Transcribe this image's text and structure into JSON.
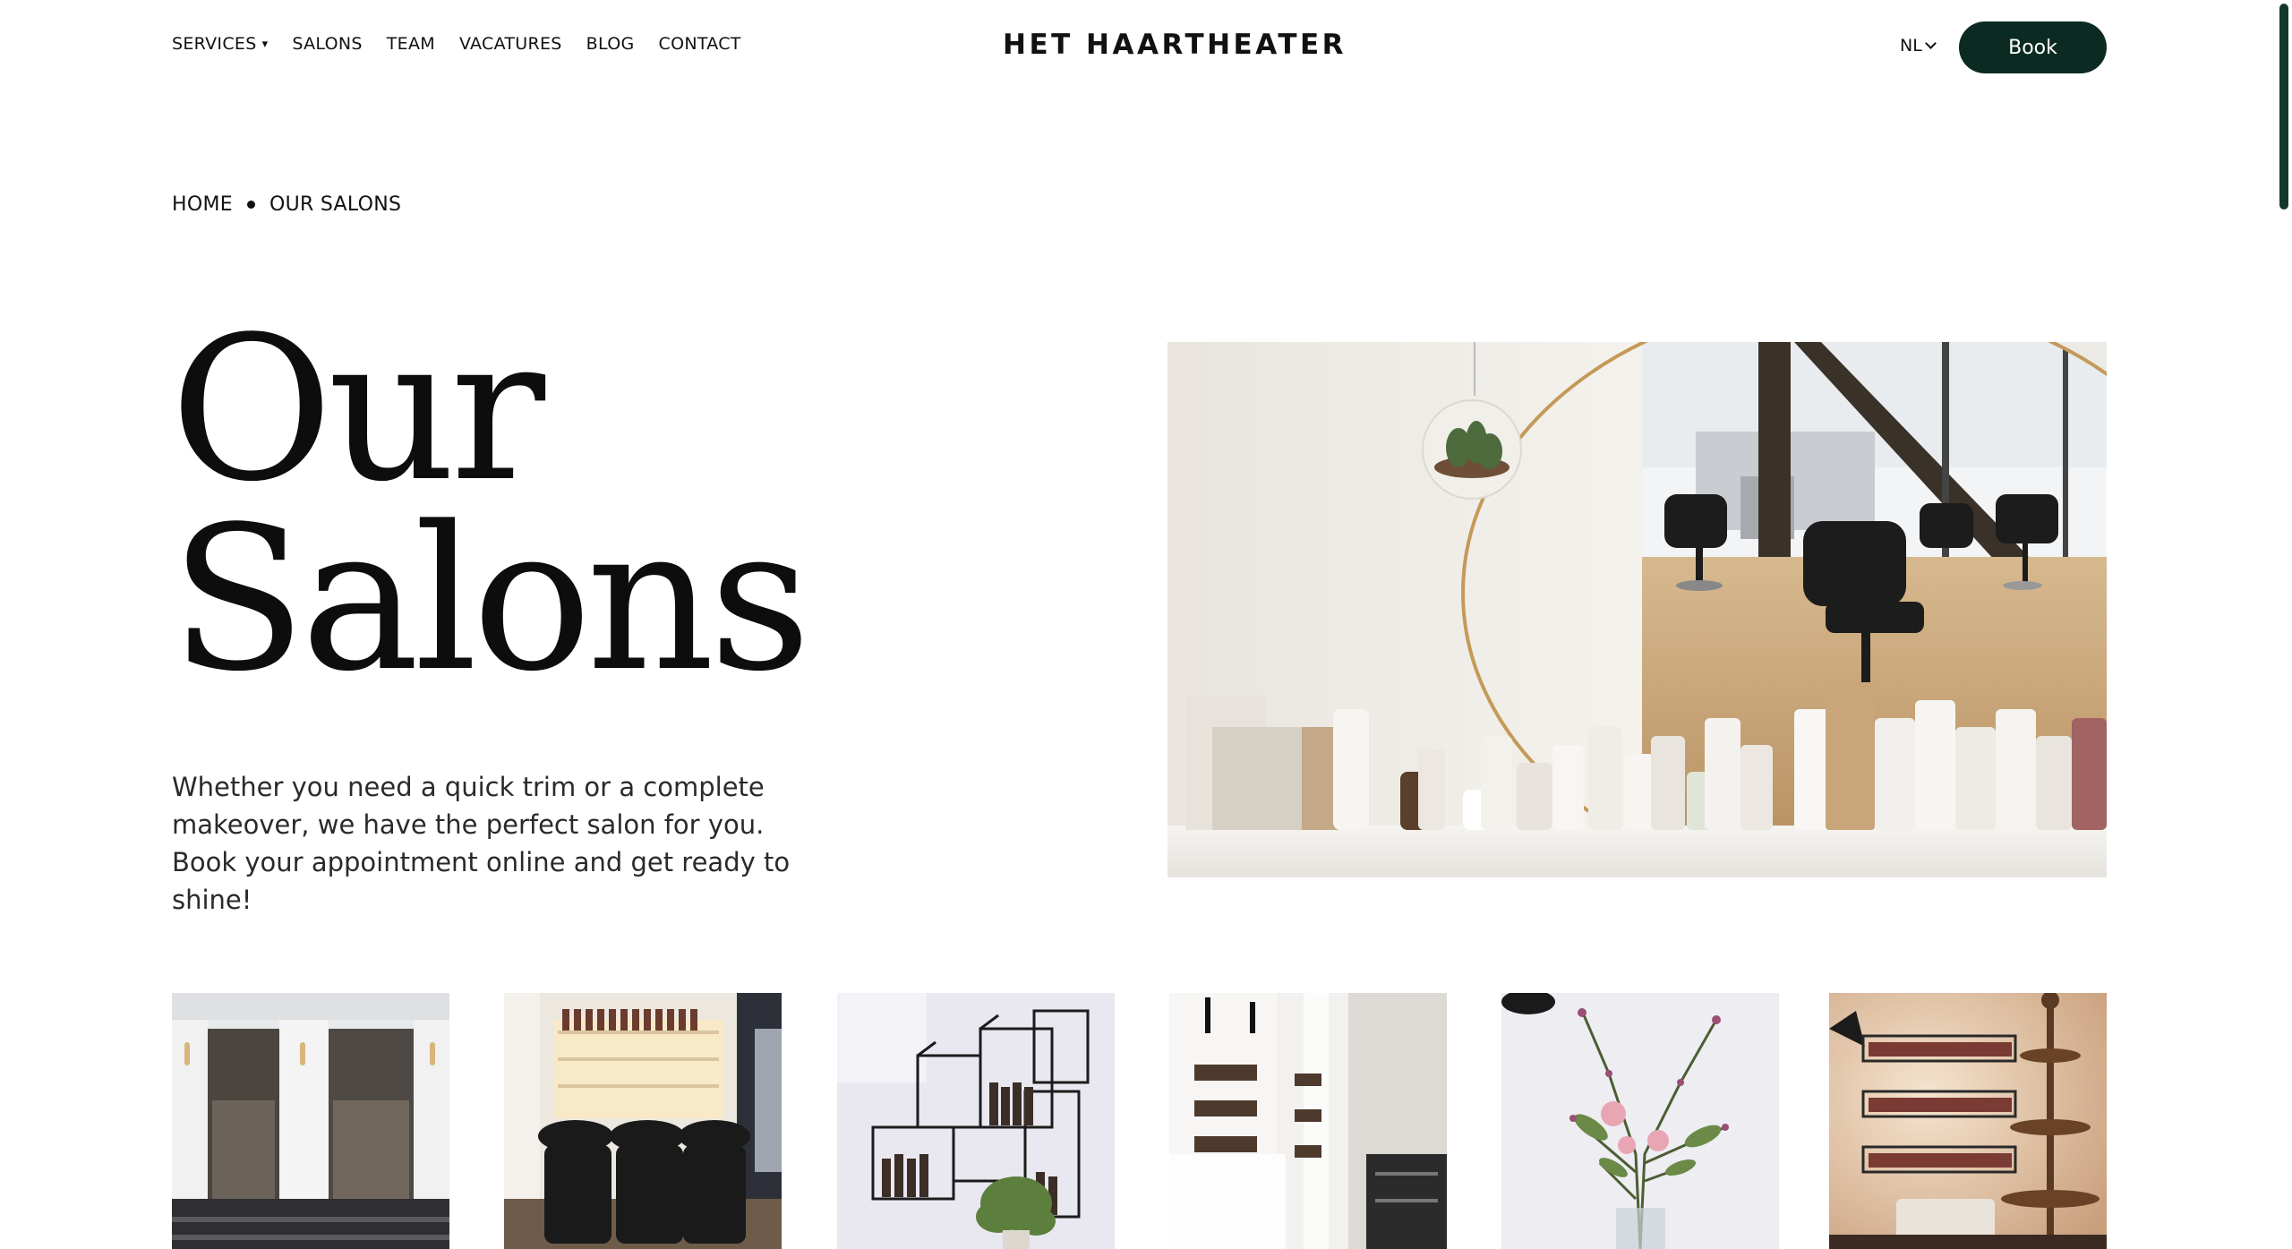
{
  "header": {
    "nav": [
      {
        "label": "SERVICES",
        "has_dropdown": true
      },
      {
        "label": "SALONS"
      },
      {
        "label": "TEAM"
      },
      {
        "label": "VACATURES"
      },
      {
        "label": "BLOG"
      },
      {
        "label": "CONTACT"
      }
    ],
    "dropdown_caret": "▾",
    "logo": "HET HAARTHEATER",
    "language": "NL",
    "book_label": "Book"
  },
  "breadcrumb": {
    "home": "HOME",
    "current": "OUR SALONS"
  },
  "hero": {
    "title_line1": "Our",
    "title_line2": "Salons",
    "intro": "Whether you need a quick trim or a complete makeover, we have the perfect salon for you. Book your appointment online and get ready to shine!"
  },
  "colors": {
    "accent": "#0b2a22",
    "text": "#111111",
    "background": "#ffffff"
  },
  "icons": {
    "dropdown": "chevron-down-icon",
    "language": "chevron-down-icon"
  }
}
